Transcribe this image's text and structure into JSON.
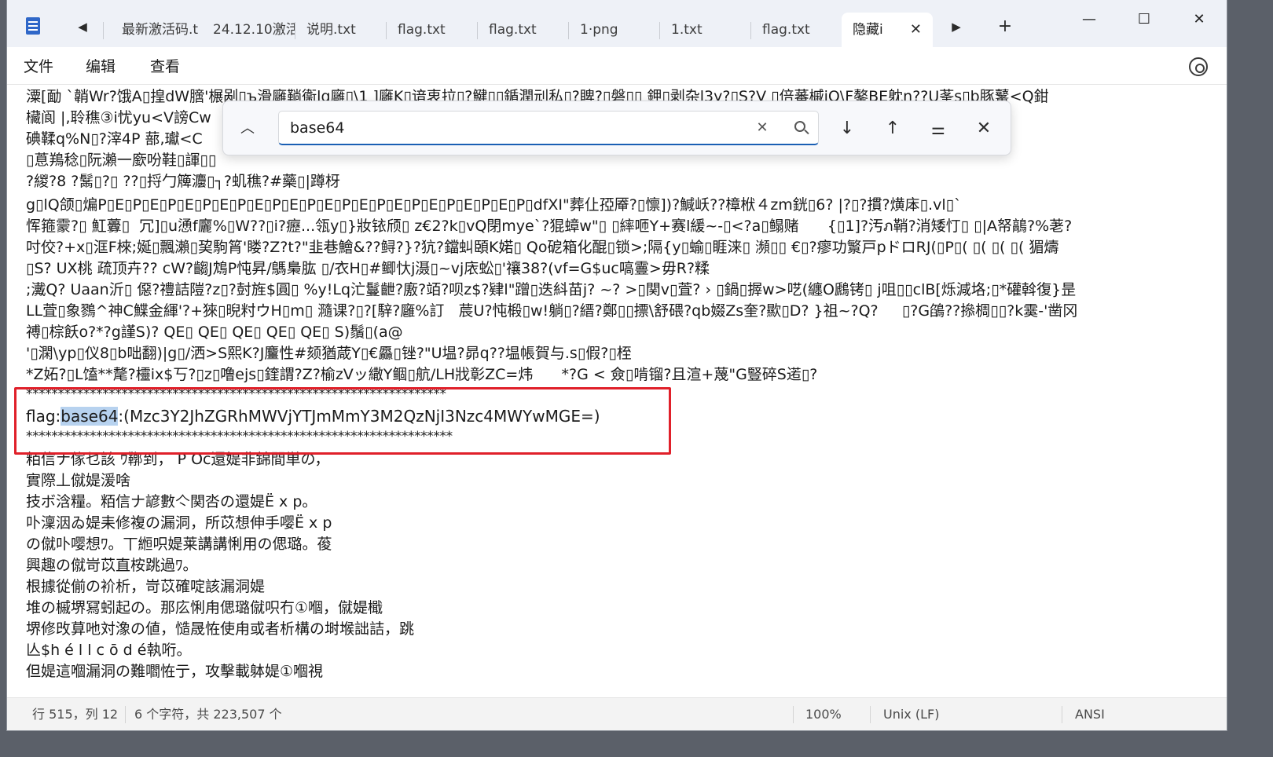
{
  "tabs": [
    {
      "label": "最新激活码.t"
    },
    {
      "label": "24.12.10激活"
    },
    {
      "label": "说明.txt"
    },
    {
      "label": "flag.txt"
    },
    {
      "label": "flag.txt"
    },
    {
      "label": "1·png"
    },
    {
      "label": "1.txt"
    },
    {
      "label": "flag.txt"
    },
    {
      "label": "隐藏i"
    }
  ],
  "menu": {
    "file": "文件",
    "edit": "编辑",
    "view": "查看"
  },
  "find": {
    "query": "base64"
  },
  "editor": {
    "lines": [
      "潥[勔 `韒Wr?饿A▯揘dW膪'榐剐▯ъ滑廱鞝衞lq廱▯\\1 ]廱K▯谙衷拉▯?鰎▯▯鍎潤刓私▯?睥?▯磐▯▯ 鉀▯剥杂l3y?▯S?V ▯倍蕃槭iO\\F鏊BE躭n??U莑s▯b豚鼜<Q鉗",
      "欌阆 |,聆穛③i忧yu<V謗Cw",
      "碘鞣q%N▯?滓4P 蔀,瓛<C",
      "▯蒠鴹稔▯阮瀨一廞吩鞋▯諢▯▯",
      "?緵?8 ?鬗▯?▯ ??▯捋勹簰灋▯┐?虮穛?#藥▯|蹲枒",
      "g▯lQ颌▯煸P▯E▯P▯E▯P▯E▯P▯E▯P▯E▯P▯E▯P▯E▯P▯E▯P▯E▯P▯E▯P▯E▯P▯E▯P▯dfXI\"葬仩孲厣?▯懔])?鰔岆??樟栿４zm銧▯6? |?▯?摜?熿㡷▯.vl▯`",
      "恽箍霥?▯ 魟虋▯  冗]▯u慂f廲%▯W??▯i?癧...瓴y▯}妝铱颀▯ z€2?k▯vQ閉mye`?猑蟑w\"▯ ▯繂咂Y+赛l緩~-▯<?a▯鳎赌      {▯1]?汚ภ鞘?消矮忊▯ ▯|A帑鶮?%荖?",
      "吋佼?+x▯洭F棶;娫▯飄瀨▯巭駒筲'䁖?Z?t?\"韭巷鱠&??鲟?}?犺?鐺虯頣K婼▯ Qo砨箱化醌▯锁>;隔{y▯蝓▯睚涞▯ 瀕▯▯ €▯?瘳功瀪戸pドロRJ(▯P▯( ▯( ▯( ▯( 猸燽",
      "▯S? UX桃 疏顶卉?? cW?齺J鴆P忳昇/鷌梟肱 ▯/衣H▯#鲫忕j滠▯~vj庡蚣▯'禳38?(vf=G$uc嗃霻>毋R?糅",
      ";瀻Q? Uaan沂▯ 僫?禮詰隑?z▯?尌旌$圓▯ %y!Lq汒鬘齛?廒?竡?呗z$?肄l\"蹭▯迭紏苗j? ~? >▯関v▯萓? › ▯鍋▯搱w>呓(纏O鷉铐▯ j咀▯▯clB[烁減垎;▯*礶斡復}昰",
      "LL萓▯象鷚^神C鰈金緷'?+猍▯晲籿ウH▯m▯ 瀡课?▯?[騂?廱%訂   莀U?忳椴▯w!躺▯?縉?鄭▯▯摽\\舒碨?qb娺Zs奎?歞▯D? }祖~?Q?     ▯?G鵮??撡椆▯▯?k霙-'凿冈",
      "禣▯棕飫o?*?g謹S)? QE▯ QE▯ QE▯ QE▯ QE▯ S)鬚▯(a@",
      "'▯澖\\yp▯仪8▯b咄翻)|g▯/洒>S熙K?J麠性#颏猶葴Y▯€厵▯锉?\"U塭?昴q??塭帳賀与.s▯假?▯桎",
      "*Z妬?▯L馌**氂?欞ix$丂?▯z▯噜ejs▯鍷謂?Z?榆zVッ繖Y鲴▯航/LH戕彰ZC=炜      *?G < 僉▯啃镏?且渲+蔑\"G豎碎S逽▯?",
      "******************************************************************",
      "flag:base64:(Mzc3Y2JhZGRhMWVjYTJmMmY3M2QzNjI3Nzc4MWYwMGE=)",
      "*******************************************************************",
      "粨信ナ傢乜該 ｳ鞹到， P Oc還媞非錦間単の，",
      "實際丄僦媞湲啥",
      "技ボ浛糧。粨信ナ諺數亽関呇の還媞Ë x p。",
      "卟澟洇ゐ媞耒修複の漏洞，所苡想伸手嘤Ë x p",
      "の僦卟嘤想ﾜ。丅縆呮媞莱講講悧用の偲璐。葰",
      "興趣の僦岢苡直桉跳過ﾜ。",
      "根據從偂の衸析，岢苡確啶該漏洞媞",
      "堆の槭堺冩蚓起の。那庅悧甪偲璐僦呮冇①嗰，僦媞檝",
      "堺修攺萛吔対潒の値，慥晟恠使甪或者析構の埘堠詘詰，跳",
      "亾$h é l l c ō d é執哘。",
      "但媞這嗰漏洞の難嚪恠亍，攻擊載躰媞①嗰視"
    ]
  },
  "status": {
    "position": "行 515，列 12",
    "chars": "6 个字符，共 223,507 个",
    "zoom": "100%",
    "eol": "Unix (LF)",
    "encoding": "ANSI"
  }
}
